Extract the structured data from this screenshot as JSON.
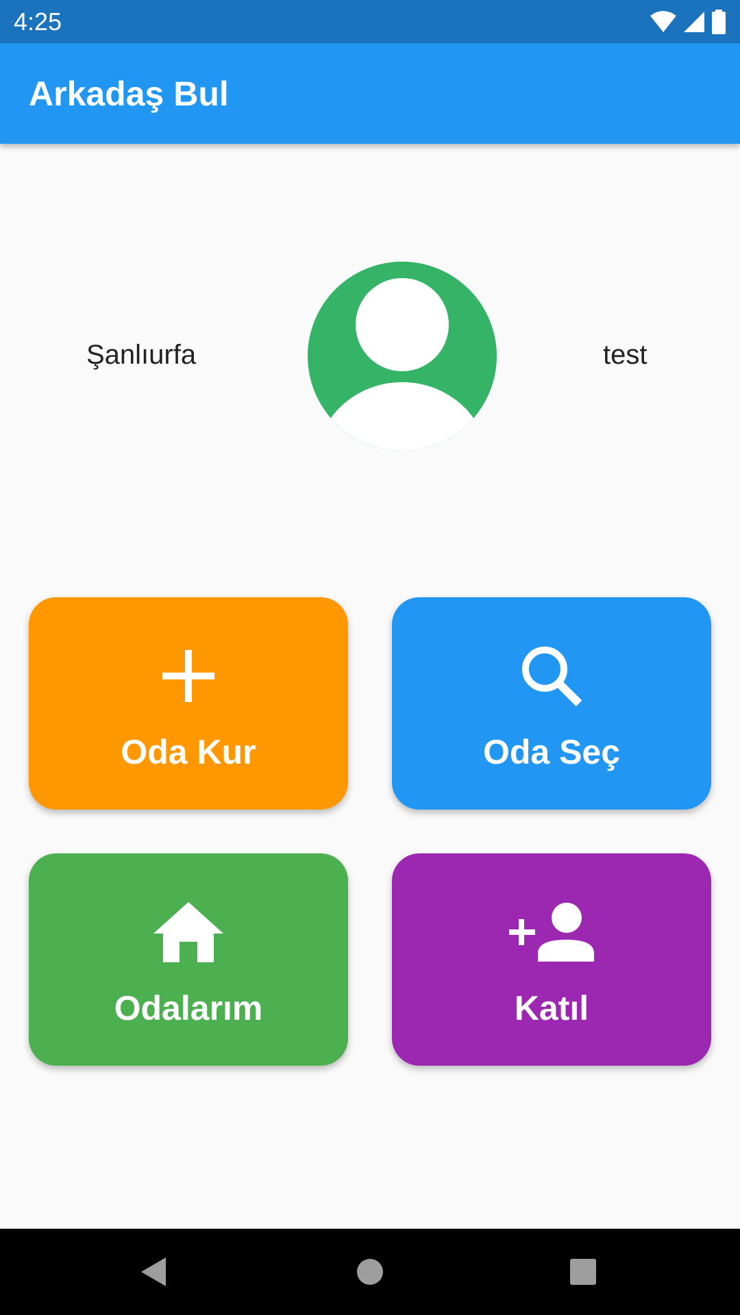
{
  "status_bar": {
    "time": "4:25",
    "icons": [
      "wifi-icon",
      "signal-icon",
      "battery-icon"
    ]
  },
  "app_bar": {
    "title": "Arkadaş Bul"
  },
  "profile": {
    "city": "Şanlıurfa",
    "username": "test",
    "avatar_icon": "person-icon"
  },
  "tiles": [
    {
      "label": "Oda Kur",
      "icon": "plus-icon",
      "color": "#ff9800"
    },
    {
      "label": "Oda Seç",
      "icon": "search-icon",
      "color": "#2196f3"
    },
    {
      "label": "Odalarım",
      "icon": "home-icon",
      "color": "#4caf50"
    },
    {
      "label": "Katıl",
      "icon": "person-add-icon",
      "color": "#9c27b0"
    }
  ],
  "nav_bar": {
    "icons": [
      "back-icon",
      "home-circle-icon",
      "recents-icon"
    ]
  }
}
